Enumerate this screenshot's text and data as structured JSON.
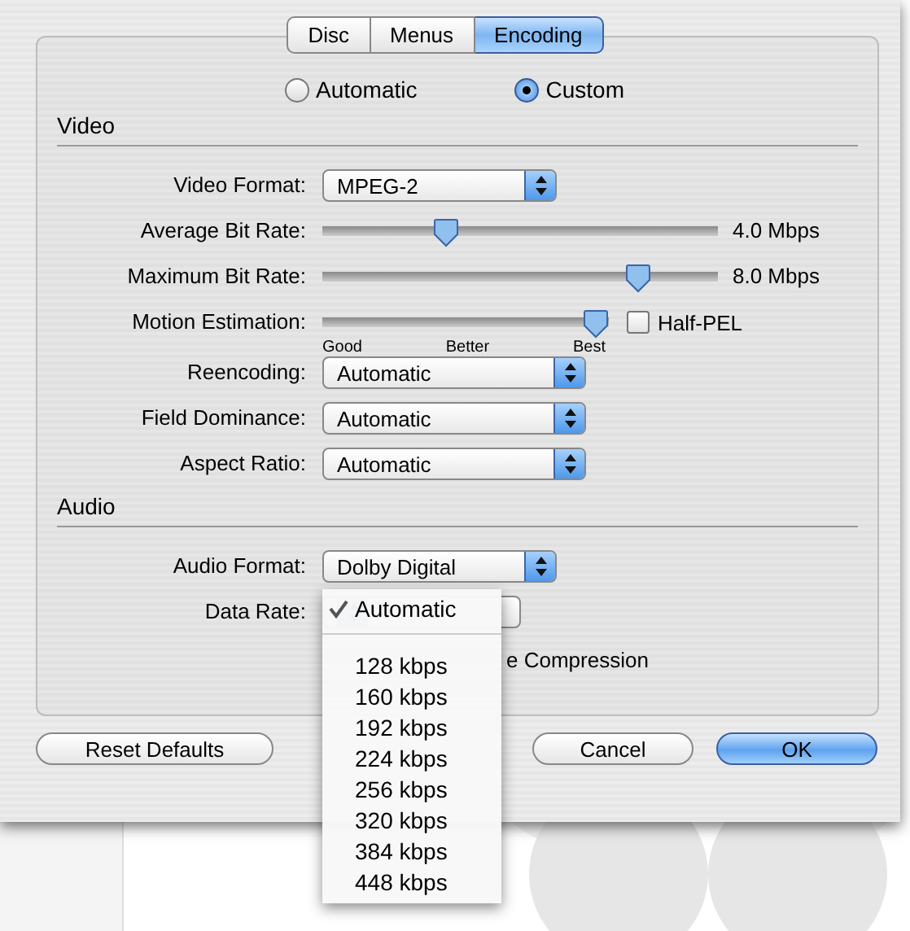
{
  "tabs": [
    {
      "label": "Disc",
      "selected": false
    },
    {
      "label": "Menus",
      "selected": false
    },
    {
      "label": "Encoding",
      "selected": true
    }
  ],
  "encoding_mode": [
    {
      "label": "Automatic",
      "selected": false
    },
    {
      "label": "Custom",
      "selected": true
    }
  ],
  "sections": [
    {
      "heading": "Video",
      "rows": [
        {
          "kind": "popup",
          "label": "Video Format:",
          "value": "MPEG-2"
        },
        {
          "kind": "slider",
          "label": "Average Bit Rate:",
          "level": 0.3,
          "reading": "4.0 Mbps"
        },
        {
          "kind": "slider",
          "label": "Maximum Bit Rate:",
          "level": 0.82,
          "reading": "8.0 Mbps"
        },
        {
          "kind": "slider_check",
          "label": "Motion Estimation:",
          "level": 1,
          "ticks": [
            "Good",
            "Better",
            "Best"
          ],
          "checkbox": {
            "label": "Half-PEL",
            "checked": false
          }
        },
        {
          "kind": "popup",
          "label": "Reencoding:",
          "value": "Automatic"
        },
        {
          "kind": "popup",
          "label": "Field Dominance:",
          "value": "Automatic"
        },
        {
          "kind": "popup",
          "label": "Aspect Ratio:",
          "value": "Automatic"
        }
      ]
    },
    {
      "heading": "Audio",
      "rows": [
        {
          "kind": "popup",
          "label": "Audio Format:",
          "value": "Dolby Digital"
        },
        {
          "kind": "popup_open",
          "label": "Data Rate:",
          "menu": [
            {
              "kind": "item",
              "label": "Automatic",
              "checked": true
            },
            {
              "kind": "separator"
            },
            {
              "kind": "item",
              "label": "128 kbps",
              "checked": false
            },
            {
              "kind": "item",
              "label": "160 kbps",
              "checked": false
            },
            {
              "kind": "item",
              "label": "192 kbps",
              "checked": false
            },
            {
              "kind": "item",
              "label": "224 kbps",
              "checked": false
            },
            {
              "kind": "item",
              "label": "256 kbps",
              "checked": false
            },
            {
              "kind": "item",
              "label": "320 kbps",
              "checked": false
            },
            {
              "kind": "item",
              "label": "384 kbps",
              "checked": false
            },
            {
              "kind": "item",
              "label": "448 kbps",
              "checked": false
            }
          ]
        },
        {
          "kind": "covered_text",
          "text": "e Compression"
        }
      ]
    }
  ],
  "buttons": [
    {
      "label": "Reset Defaults",
      "default": false
    },
    {
      "label": "Cancel",
      "default": false
    },
    {
      "label": "OK",
      "default": true
    }
  ]
}
